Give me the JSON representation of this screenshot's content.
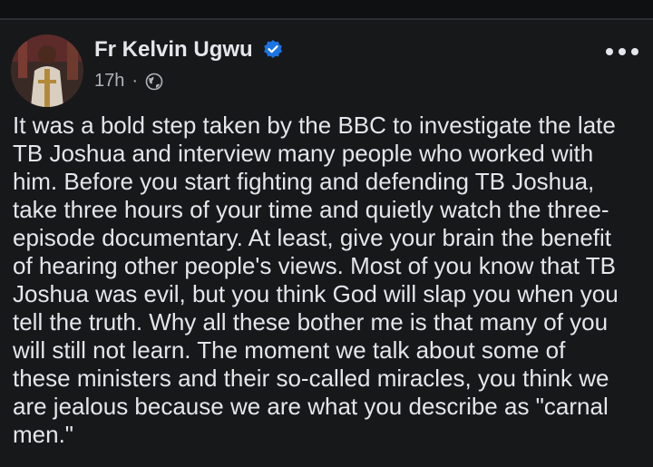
{
  "post": {
    "author": "Fr Kelvin Ugwu",
    "time": "17h",
    "separator": "·",
    "body_lines": [
      "It was a bold step taken by the BBC to investigate the late",
      "TB Joshua and interview many people who worked with",
      "him. Before you start fighting and defending TB Joshua,",
      "take three hours of your time and quietly watch the three-",
      "episode documentary. At least, give your brain the benefit",
      "of hearing other people's views. Most of you know that TB",
      "Joshua was evil, but you think God will slap you when you",
      "tell the truth. Why all these bother me is that many of you",
      "will still not learn. The moment we talk about some of",
      "these ministers and their so-called miracles, you think we",
      "are jealous because we are what you describe as \"carnal",
      "men.\""
    ]
  },
  "colors": {
    "background": "#17181a",
    "text": "#e4e6eb",
    "secondary_text": "#b0b3b8",
    "verified_badge": "#1b74e4"
  },
  "icons": {
    "verified": "verified-badge-icon",
    "audience": "globe-icon",
    "more": "more-options-icon"
  }
}
